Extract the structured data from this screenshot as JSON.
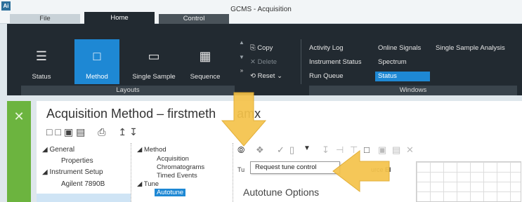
{
  "app": {
    "logo_text": "Ai",
    "title": "GCMS - Acquisition"
  },
  "tabs": {
    "file": "File",
    "home": "Home",
    "control": "Control"
  },
  "ribbon": {
    "layouts": {
      "label": "Layouts",
      "buttons": [
        {
          "label": "Status",
          "icon": "list-icon"
        },
        {
          "label": "Method",
          "icon": "method-icon",
          "active": true
        },
        {
          "label": "Single Sample",
          "icon": "single-sample-icon"
        },
        {
          "label": "Sequence",
          "icon": "sequence-icon"
        }
      ]
    },
    "edit": {
      "copy": "Copy",
      "delete": "Delete",
      "reset": "Reset"
    },
    "windows": {
      "label": "Windows",
      "activity_log": "Activity Log",
      "online_signals": "Online Signals",
      "single_sample_analysis": "Single Sample Analysis",
      "instrument_status": "Instrument Status",
      "spectrum": "Spectrum",
      "run_queue": "Run Queue",
      "status": "Status"
    }
  },
  "panel": {
    "title_part1": "Acquisition Method – firstmeth",
    "title_part2": "amx"
  },
  "tree": {
    "general": "General",
    "properties": "Properties",
    "instrument_setup": "Instrument Setup",
    "agilent": "Agilent 7890B"
  },
  "tree2": {
    "method": "Method",
    "acquisition": "Acquisition",
    "chromatograms": "Chromatograms",
    "timed_events": "Timed Events",
    "tune": "Tune",
    "autotune": "Autotune"
  },
  "right": {
    "tooltip": "Request tune control",
    "tu": "Tu",
    "source_label": "urce",
    "source_value": "EI",
    "autotune_options": "Autotune Options"
  },
  "colors": {
    "accent": "#1e88d4",
    "ribbon_bg": "#222a31",
    "green": "#6cb43f",
    "arrow": "#f5c34a"
  }
}
